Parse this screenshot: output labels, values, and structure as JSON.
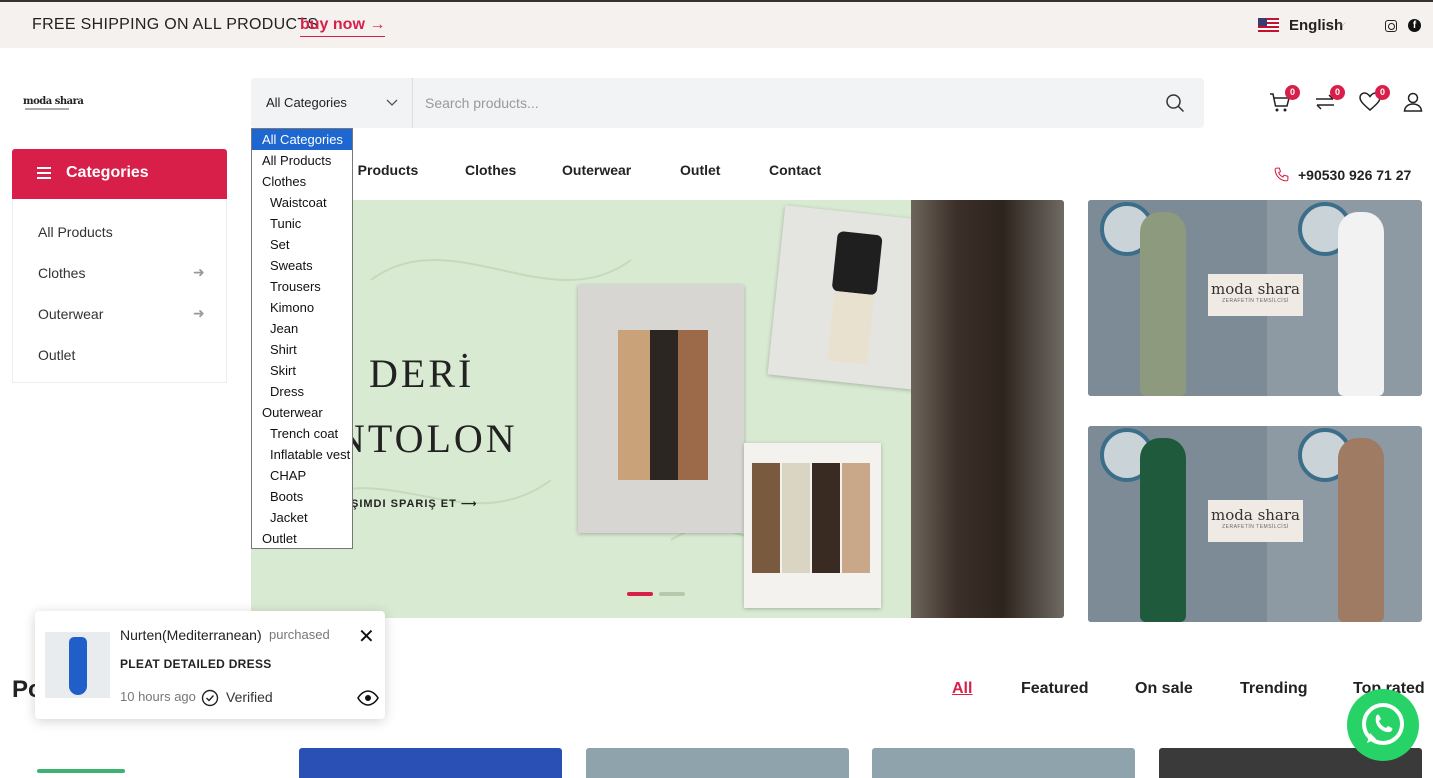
{
  "announcement": {
    "text": "FREE SHIPPING ON ALL PRODUCTS",
    "link_label": "buy now",
    "link_arrow": "→"
  },
  "language": {
    "label": "English",
    "caret": "⌵"
  },
  "social": {
    "facebook_glyph": "f",
    "icons": [
      "instagram-icon",
      "facebook-icon"
    ]
  },
  "brand": {
    "logo_text": "moda shara"
  },
  "search": {
    "category_label": "All Categories",
    "placeholder": "Search products...",
    "dropdown_options": [
      {
        "label": "All Categories",
        "level": 0,
        "selected": true
      },
      {
        "label": "All Products",
        "level": 0
      },
      {
        "label": "Clothes",
        "level": 0
      },
      {
        "label": "Waistcoat",
        "level": 1
      },
      {
        "label": "Tunic",
        "level": 1
      },
      {
        "label": "Set",
        "level": 1
      },
      {
        "label": "Sweats",
        "level": 1
      },
      {
        "label": "Trousers",
        "level": 1
      },
      {
        "label": "Kimono",
        "level": 1
      },
      {
        "label": "Jean",
        "level": 1
      },
      {
        "label": "Shirt",
        "level": 1
      },
      {
        "label": "Skirt",
        "level": 1
      },
      {
        "label": "Dress",
        "level": 1
      },
      {
        "label": "Outerwear",
        "level": 0
      },
      {
        "label": "Trench coat",
        "level": 1
      },
      {
        "label": "Inflatable vest",
        "level": 1
      },
      {
        "label": "CHAP",
        "level": 1
      },
      {
        "label": "Boots",
        "level": 1
      },
      {
        "label": "Jacket",
        "level": 1
      },
      {
        "label": "Outlet",
        "level": 0
      }
    ]
  },
  "header_icons": {
    "cart_count": "0",
    "compare_count": "0",
    "wishlist_count": "0"
  },
  "sidebar": {
    "title": "Categories",
    "items": [
      {
        "label": "All Products",
        "has_arrow": false
      },
      {
        "label": "Clothes",
        "has_arrow": true
      },
      {
        "label": "Outerwear",
        "has_arrow": true
      },
      {
        "label": "Outlet",
        "has_arrow": false
      }
    ],
    "arrow": "➜"
  },
  "nav": {
    "items": [
      "ll Products",
      "Clothes",
      "Outerwear",
      "Outlet",
      "Contact"
    ],
    "phone": "+90530 926 71 27"
  },
  "hero": {
    "title_line1": "DERİ",
    "title_line2": "NTOLON",
    "cta": "ŞIMDI SPARIŞ ET ⟶"
  },
  "side_banners": [
    {
      "logo": "moda shara",
      "tagline": "ZERAFETİN TEMSİLCİSİ"
    },
    {
      "logo": "moda shara",
      "tagline": "ZERAFETİN TEMSİLCİSİ"
    }
  ],
  "products_section": {
    "title": "Po",
    "tabs": [
      {
        "label": "All",
        "active": true
      },
      {
        "label": "Featured",
        "active": false
      },
      {
        "label": "On sale",
        "active": false
      },
      {
        "label": "Trending",
        "active": false
      },
      {
        "label": "Top rated",
        "active": false
      }
    ]
  },
  "toast": {
    "customer": "Nurten(Mediterranean)",
    "action": "purchased",
    "product": "PLEAT DETAILED DRESS",
    "time": "10 hours ago",
    "verified": "Verified",
    "close": "✕"
  },
  "colors": {
    "accent": "#d81f4a",
    "topbar_bg": "#f4f1ee",
    "hero_bg": "#d9ead3",
    "whatsapp": "#27d366",
    "select_blue": "#1e66d0"
  }
}
